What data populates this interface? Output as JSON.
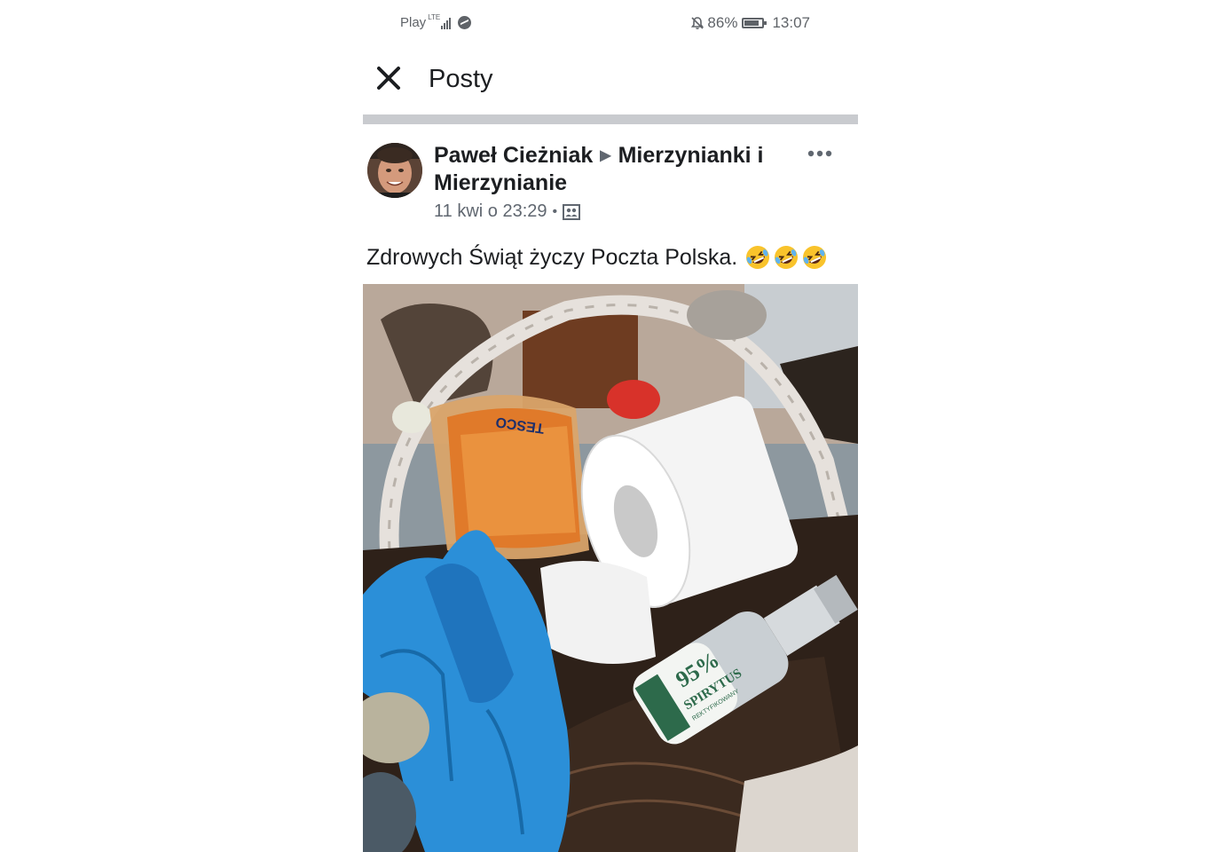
{
  "status_bar": {
    "carrier": "Play",
    "network": "LTE",
    "battery": "86%",
    "battery_level": 0.86,
    "time": "13:07",
    "icons": [
      "signal-icon",
      "messenger-icon",
      "bell-off-icon",
      "battery-icon"
    ]
  },
  "header": {
    "title": "Posty",
    "close_icon": "close-icon"
  },
  "post": {
    "author": "Paweł Cieżniak",
    "group": "Mierzynianki i Mierzynianie",
    "timestamp": "11 kwi o 23:29",
    "separator": "•",
    "audience_icon": "group-audience-icon",
    "more_icon": "more-options-icon",
    "text": "Zdrowych Świąt życzy Poczta Polska.",
    "emojis": [
      "rolling-on-floor-laughing",
      "rolling-on-floor-laughing",
      "rolling-on-floor-laughing"
    ],
    "image": {
      "label_brand": "TESCO",
      "bottle_label_percent": "95%",
      "bottle_label_name": "SPIRYTUS",
      "bottle_label_sub": "REKTYFIKOWANY"
    }
  },
  "colors": {
    "text_primary": "#1c1e21",
    "text_secondary": "#606770",
    "divider": "#c9cbcf",
    "glove_blue": "#2b8fd8"
  }
}
